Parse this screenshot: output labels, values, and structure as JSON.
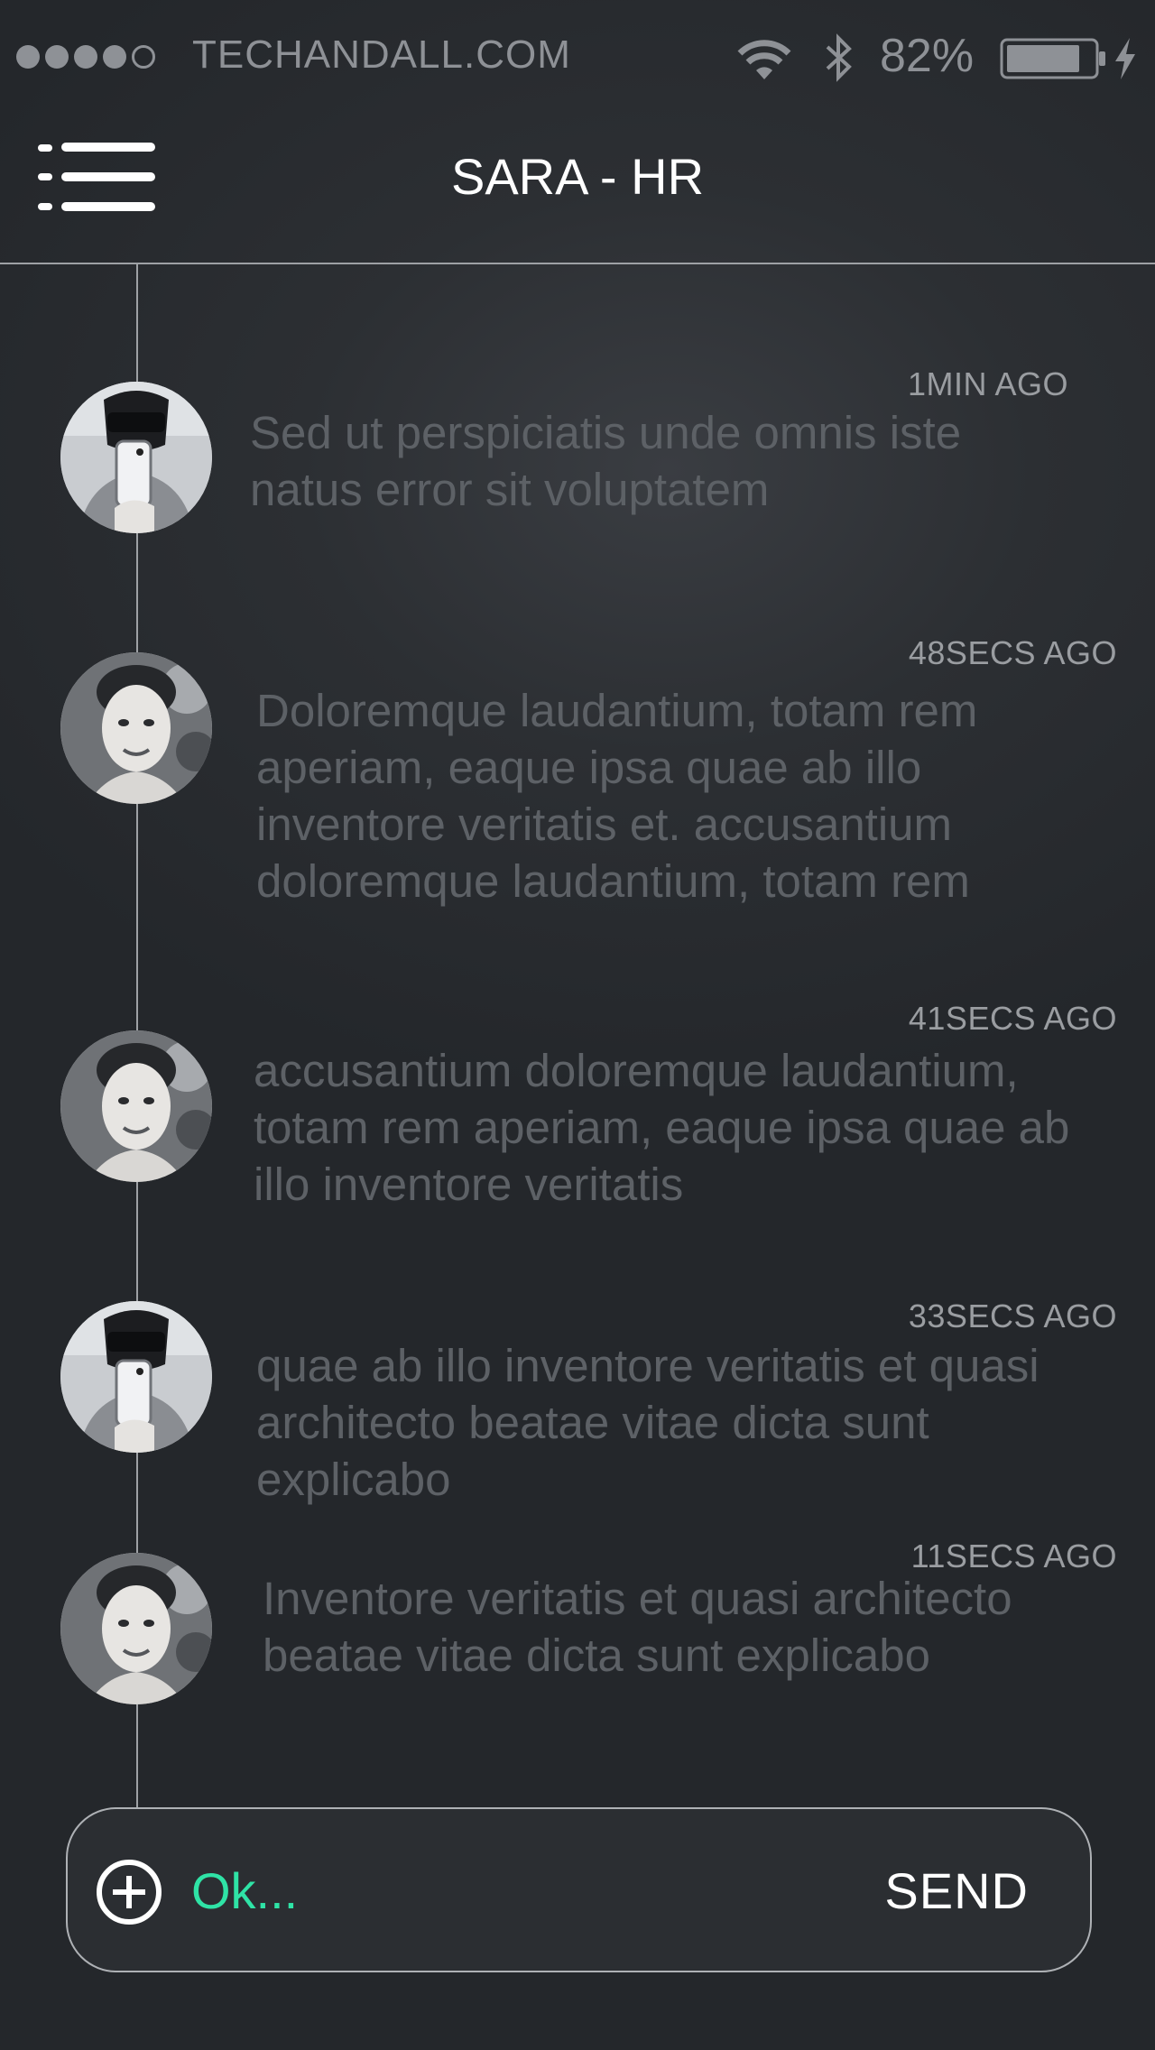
{
  "status_bar": {
    "carrier": "TECHANDALL.COM",
    "battery_percent": "82%",
    "signal_bars_filled": 4,
    "signal_bars_total": 5,
    "battery_level": 0.82,
    "icons": [
      "wifi-icon",
      "bluetooth-icon",
      "battery-icon",
      "charging-bolt-icon"
    ]
  },
  "header": {
    "title": "SARA - HR",
    "menu_icon": "menu-list-icon"
  },
  "messages": [
    {
      "timestamp": "1MIN AGO",
      "text": "Sed ut perspiciatis unde omnis iste natus error sit voluptatem",
      "avatar": "man-selfie-avatar"
    },
    {
      "timestamp": "48SECS AGO",
      "text": "Doloremque laudantium, totam rem aperiam, eaque ipsa quae ab illo inventore veritatis et. accusantium doloremque laudantium, totam rem",
      "avatar": "woman-portrait-avatar"
    },
    {
      "timestamp": "41SECS AGO",
      "text": "accusantium doloremque laudantium, totam rem aperiam, eaque ipsa quae ab illo inventore veritatis",
      "avatar": "woman-portrait-avatar"
    },
    {
      "timestamp": "33SECS AGO",
      "text": "quae ab illo inventore veritatis et quasi architecto beatae vitae dicta sunt explicabo",
      "avatar": "man-selfie-avatar"
    },
    {
      "timestamp": "11SECS AGO",
      "text": "Inventore veritatis et quasi architecto beatae vitae dicta sunt explicabo",
      "avatar": "woman-portrait-avatar"
    }
  ],
  "composer": {
    "input_value": "Ok...",
    "send_label": "SEND",
    "add_icon": "plus-circle-icon"
  },
  "colors": {
    "background": "#2c2f33",
    "accent": "#2fe3a6",
    "message_text": "#5d6166",
    "timestamp_text": "#9a9da1"
  }
}
